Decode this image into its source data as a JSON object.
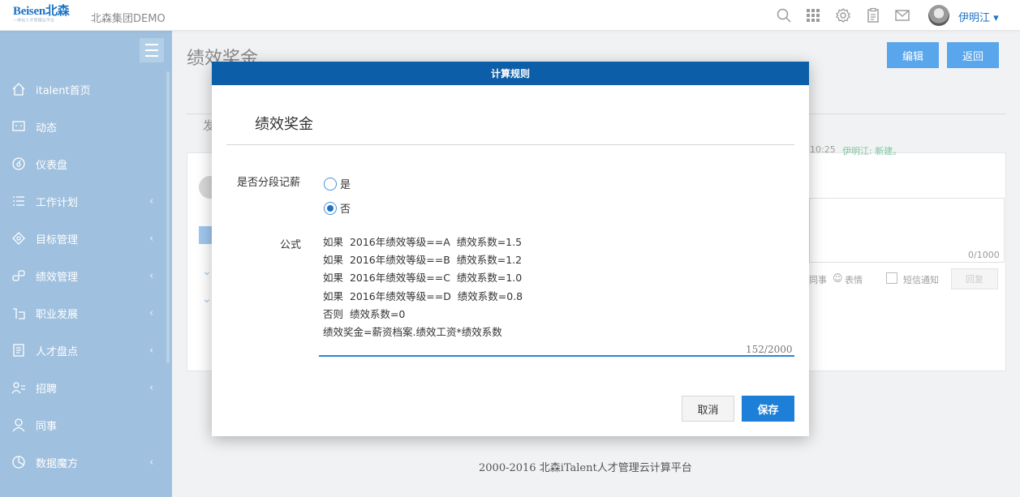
{
  "topbar": {
    "logo_text": "Beisen北森",
    "logo_subtitle": "一体化人才管理云平台",
    "company": "北森集团DEMO",
    "icons": [
      "search-icon",
      "apps-grid-icon",
      "gear-icon",
      "clipboard-icon",
      "mail-icon"
    ],
    "username": "伊明江 ▾"
  },
  "sidebar": {
    "items": [
      {
        "label": "italent首页",
        "icon": "home-icon",
        "arrow": ""
      },
      {
        "label": "动态",
        "icon": "chat-icon",
        "arrow": ""
      },
      {
        "label": "仪表盘",
        "icon": "dashboard-icon",
        "arrow": ""
      },
      {
        "label": "工作计划",
        "icon": "list-icon",
        "arrow": "‹"
      },
      {
        "label": "目标管理",
        "icon": "target-icon",
        "arrow": "‹"
      },
      {
        "label": "绩效管理",
        "icon": "link-icon",
        "arrow": "‹"
      },
      {
        "label": "职业发展",
        "icon": "career-icon",
        "arrow": "‹"
      },
      {
        "label": "人才盘点",
        "icon": "report-icon",
        "arrow": "‹"
      },
      {
        "label": "招聘",
        "icon": "recruit-icon",
        "arrow": "‹"
      },
      {
        "label": "同事",
        "icon": "person-icon",
        "arrow": ""
      },
      {
        "label": "数据魔方",
        "icon": "pie-icon",
        "arrow": "‹"
      }
    ]
  },
  "main": {
    "page_title": "绩效奖金",
    "edit_label": "编辑",
    "back_label": "返回",
    "tab_fragment": "发",
    "log_time": "10:25",
    "log_text": "伊明江: 新建。",
    "char_count": "0/1000",
    "share_fragment": "同事",
    "emoji_label": "表情",
    "sms_label": "短信通知",
    "reply_label": "回复",
    "footer": "2000-2016 北森iTalent人才管理云计算平台"
  },
  "modal": {
    "header": "计算规则",
    "title": "绩效奖金",
    "segment_label": "是否分段记薪",
    "options": [
      {
        "label": "是",
        "checked": false
      },
      {
        "label": "否",
        "checked": true
      }
    ],
    "formula_label": "公式",
    "formula_lines": [
      "如果  2016年绩效等级==A  绩效系数=1.5",
      "如果  2016年绩效等级==B  绩效系数=1.2",
      "如果  2016年绩效等级==C  绩效系数=1.0",
      "如果  2016年绩效等级==D  绩效系数=0.8",
      "否则  绩效系数=0",
      "绩效奖金=薪资档案.绩效工资*绩效系数"
    ],
    "formula_count": "152/2000",
    "cancel_label": "取消",
    "save_label": "保存"
  }
}
